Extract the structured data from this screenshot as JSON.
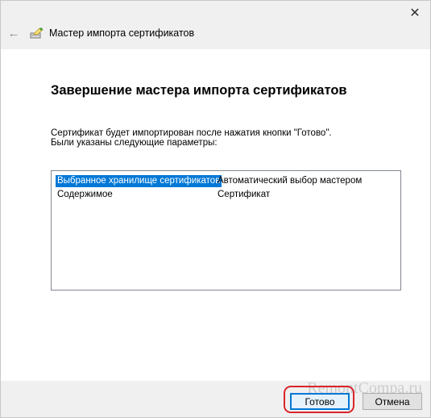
{
  "window": {
    "title": "Мастер импорта сертификатов",
    "close_glyph": "✕",
    "back_glyph": "←"
  },
  "content": {
    "heading": "Завершение мастера импорта сертификатов",
    "description": "Сертификат будет импортирован после нажатия кнопки \"Готово\".",
    "params_label": "Были указаны следующие параметры:",
    "params": [
      {
        "key": "Выбранное хранилище сертификатов",
        "value": "Автоматический выбор мастером",
        "selected": true
      },
      {
        "key": "Содержимое",
        "value": "Сертификат",
        "selected": false
      }
    ]
  },
  "buttons": {
    "finish_label": "Готово",
    "cancel_label": "Отмена"
  },
  "watermark": "RemontCompa.ru",
  "colors": {
    "selection": "#0078d7",
    "highlight_ring": "#d9242b"
  }
}
